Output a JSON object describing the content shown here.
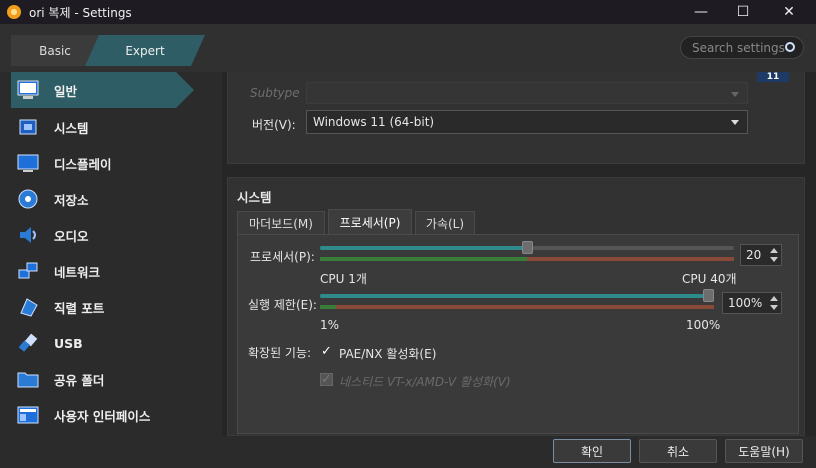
{
  "window": {
    "title": "ori 복제 - Settings",
    "controls": {
      "minimize": "—",
      "maximize": "☐",
      "close": "✕"
    }
  },
  "mode": {
    "basic": "Basic",
    "expert": "Expert"
  },
  "search": {
    "placeholder": "Search settings"
  },
  "sidebar": {
    "items": [
      {
        "label": "일반",
        "icon": "monitor-icon",
        "active": true
      },
      {
        "label": "시스템",
        "icon": "chip-icon"
      },
      {
        "label": "디스플레이",
        "icon": "display-icon"
      },
      {
        "label": "저장소",
        "icon": "disk-icon"
      },
      {
        "label": "오디오",
        "icon": "speaker-icon"
      },
      {
        "label": "네트워크",
        "icon": "network-icon"
      },
      {
        "label": "직렬 포트",
        "icon": "serial-port-icon"
      },
      {
        "label": "USB",
        "icon": "usb-icon"
      },
      {
        "label": "공유 폴더",
        "icon": "folder-icon"
      },
      {
        "label": "사용자 인터페이스",
        "icon": "ui-icon"
      }
    ]
  },
  "general": {
    "subtype_label": "Subtype",
    "version_label": "버전(V):",
    "version_value": "Windows 11 (64-bit)",
    "os_badge": "11"
  },
  "system": {
    "title": "시스템",
    "tabs": [
      {
        "label": "마더보드(M)"
      },
      {
        "label": "프로세서(P)",
        "active": true
      },
      {
        "label": "가속(L)"
      }
    ],
    "processor": {
      "label": "프로세서(P):",
      "value": "20",
      "fraction": 0.5,
      "min_label": "CPU 1개",
      "max_label": "CPU 40개"
    },
    "exec_cap": {
      "label": "실행 제한(E):",
      "value": "100%",
      "fraction": 1.0,
      "min_label": "1%",
      "max_label": "100%"
    },
    "extended_label": "확장된 기능:",
    "pae_label": "PAE/NX 활성화(E)",
    "pae_checked": true,
    "vtx_label": "네스티드 VT-x/AMD-V 활성화(V)",
    "vtx_checked": true
  },
  "buttons": {
    "ok": "확인",
    "cancel": "취소",
    "help": "도움말(H)"
  },
  "colors": {
    "accent": "#2e5d66",
    "slider_fill": "#2e8b8b",
    "tick_green": "#3a7d3a",
    "tick_red": "#8a4a3a"
  }
}
